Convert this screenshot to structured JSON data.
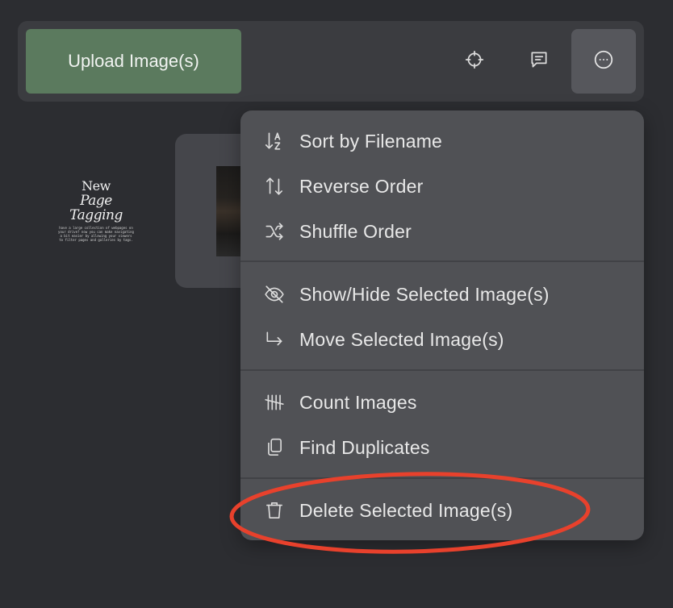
{
  "toolbar": {
    "upload_label": "Upload Image(s)",
    "icons": [
      "crosshair-icon",
      "comment-icon",
      "more-options-icon"
    ]
  },
  "poster": {
    "title_line1": "New",
    "title_line2": "Page Tagging",
    "blurb": "have a large collection of webpages on your drive? now you can make navigating a bit easier by allowing your viewers to filter pages and galleries by tags."
  },
  "menu": {
    "items": [
      {
        "label": "Sort by Filename",
        "icon": "sort-az-icon"
      },
      {
        "label": "Reverse Order",
        "icon": "reverse-order-icon"
      },
      {
        "label": "Shuffle Order",
        "icon": "shuffle-icon"
      },
      {
        "label": "Show/Hide Selected Image(s)",
        "icon": "eye-off-icon"
      },
      {
        "label": "Move Selected Image(s)",
        "icon": "move-arrow-icon"
      },
      {
        "label": "Count Images",
        "icon": "tally-icon"
      },
      {
        "label": "Find Duplicates",
        "icon": "duplicate-icon"
      },
      {
        "label": "Delete Selected Image(s)",
        "icon": "trash-icon"
      }
    ]
  },
  "colors": {
    "background": "#2c2d31",
    "toolbar": "#3b3c40",
    "upload_button": "#5b7a5e",
    "menu": "#505155",
    "annotation": "#e8412c"
  }
}
